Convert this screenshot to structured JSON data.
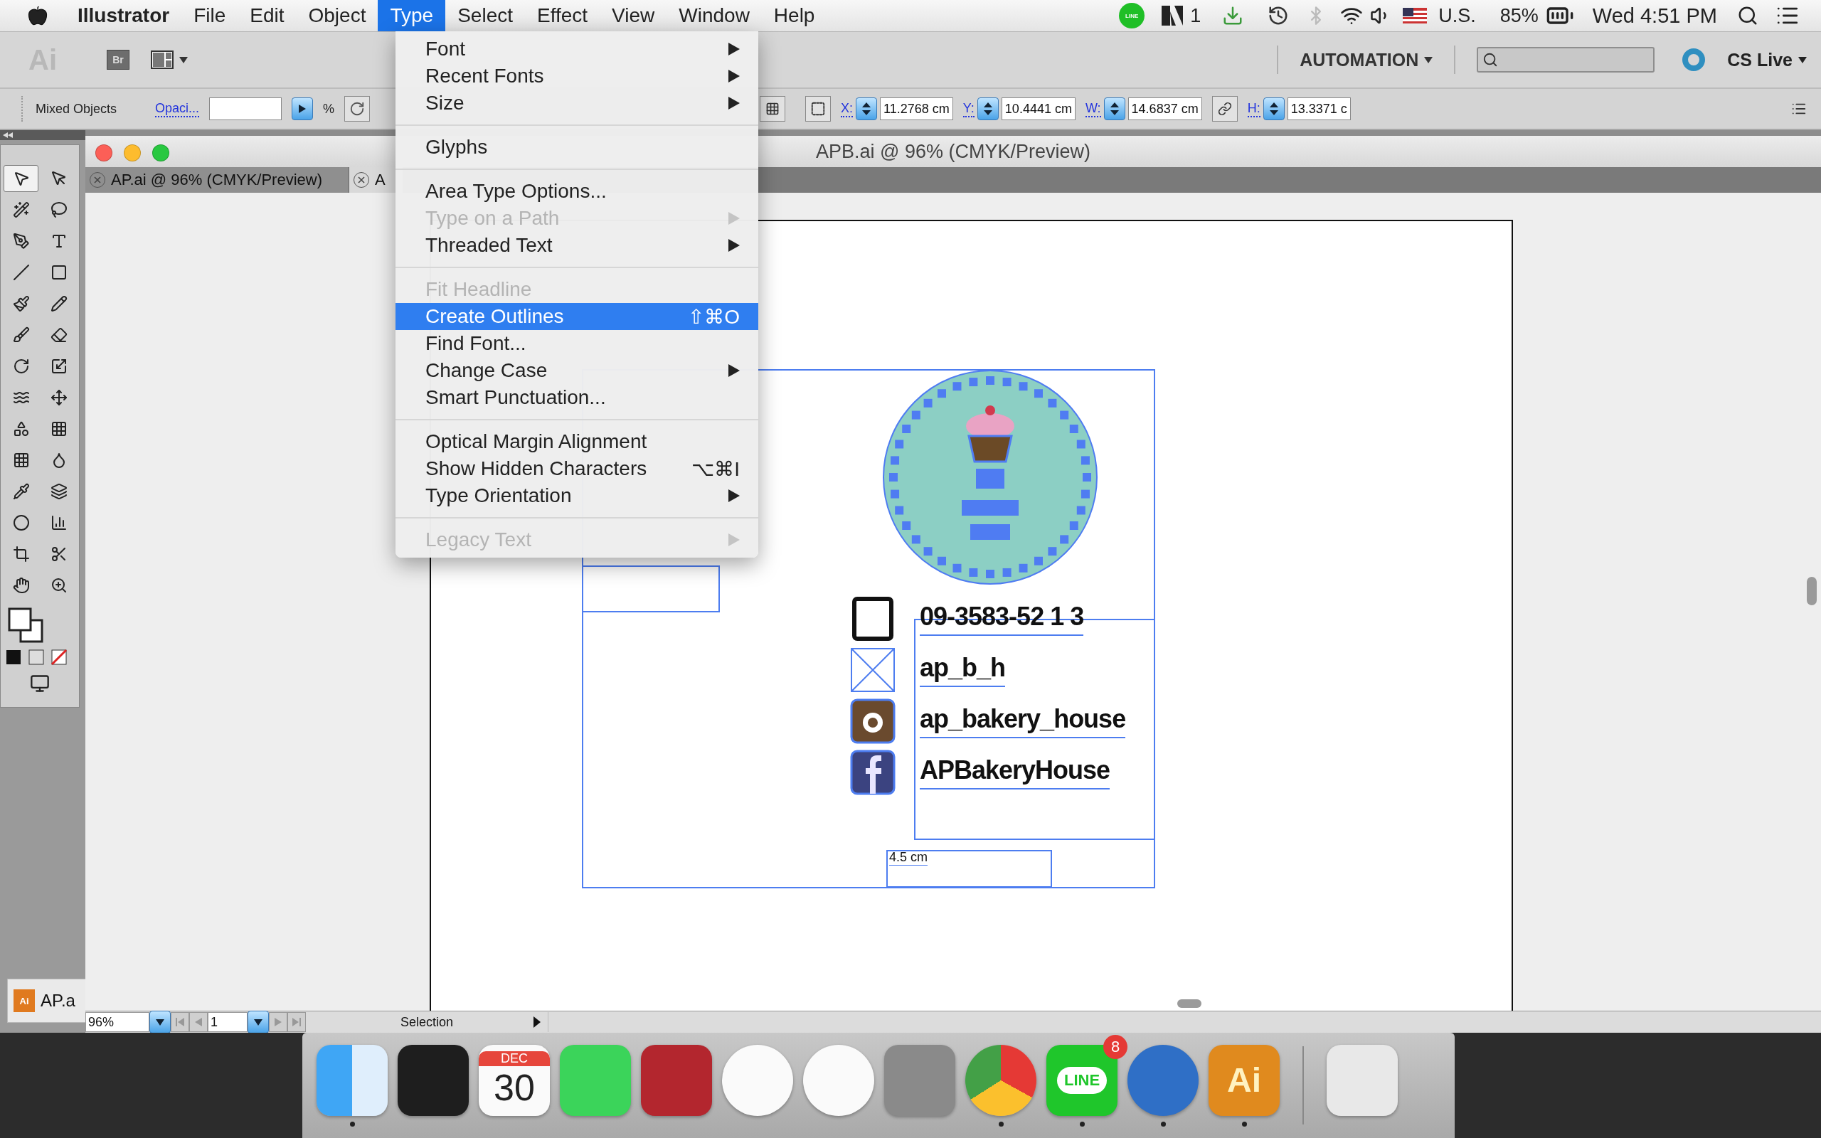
{
  "menu_bar": {
    "app_name": "Illustrator",
    "menus": [
      {
        "label": "File",
        "selected": false
      },
      {
        "label": "Edit",
        "selected": false
      },
      {
        "label": "Object",
        "selected": false
      },
      {
        "label": "Type",
        "selected": true
      },
      {
        "label": "Select",
        "selected": false
      },
      {
        "label": "Effect",
        "selected": false
      },
      {
        "label": "View",
        "selected": false
      },
      {
        "label": "Window",
        "selected": false
      },
      {
        "label": "Help",
        "selected": false
      }
    ],
    "status": {
      "line_label": "LINE",
      "adobe_count": "1",
      "input_source": "U.S.",
      "battery": "85%",
      "clock": "Wed 4:51 PM"
    }
  },
  "app_bar": {
    "logo": "Ai",
    "bridge": "Br",
    "workspace": "AUTOMATION",
    "cs_live": "CS Live"
  },
  "control_bar": {
    "selection": "Mixed Objects",
    "opacity_label": "Opaci...",
    "opacity_unit": "%",
    "fields": [
      {
        "label": "X:",
        "value": "11.2768 cm"
      },
      {
        "label": "Y:",
        "value": "10.4441 cm"
      },
      {
        "label": "W:",
        "value": "14.6837 cm"
      },
      {
        "label": "H:",
        "value": "13.3371 c"
      }
    ]
  },
  "minimized_window": {
    "file_icon_label": "Ai",
    "label": "AP.a"
  },
  "document": {
    "title": "APB.ai @ 96% (CMYK/Preview)",
    "tabs": [
      {
        "label": "AP.ai @ 96% (CMYK/Preview)",
        "selected": false
      },
      {
        "label": "A",
        "selected": true
      }
    ],
    "artwork": {
      "contact_lines": [
        {
          "kind": "phone",
          "text": "09-3583-52 1 3"
        },
        {
          "kind": "placeholder",
          "text": "ap_b_h"
        },
        {
          "kind": "instagram",
          "text": "ap_bakery_house"
        },
        {
          "kind": "facebook",
          "text": "APBakeryHouse"
        }
      ],
      "dimension_label": "4.5 cm"
    },
    "status_bar": {
      "zoom": "96%",
      "page": "1",
      "tool": "Selection"
    }
  },
  "type_menu": {
    "items": [
      {
        "kind": "item",
        "label": "Font",
        "submenu": true,
        "disabled": false,
        "selected": false
      },
      {
        "kind": "item",
        "label": "Recent Fonts",
        "submenu": true,
        "disabled": false,
        "selected": false
      },
      {
        "kind": "item",
        "label": "Size",
        "submenu": true,
        "disabled": false,
        "selected": false
      },
      {
        "kind": "separator"
      },
      {
        "kind": "item",
        "label": "Glyphs",
        "submenu": false,
        "disabled": false,
        "selected": false
      },
      {
        "kind": "separator"
      },
      {
        "kind": "item",
        "label": "Area Type Options...",
        "submenu": false,
        "disabled": false,
        "selected": false
      },
      {
        "kind": "item",
        "label": "Type on a Path",
        "submenu": true,
        "disabled": true,
        "selected": false
      },
      {
        "kind": "item",
        "label": "Threaded Text",
        "submenu": true,
        "disabled": false,
        "selected": false
      },
      {
        "kind": "separator"
      },
      {
        "kind": "item",
        "label": "Fit Headline",
        "submenu": false,
        "disabled": true,
        "selected": false
      },
      {
        "kind": "item",
        "label": "Create Outlines",
        "shortcut": "⇧⌘O",
        "submenu": false,
        "disabled": false,
        "selected": true
      },
      {
        "kind": "item",
        "label": "Find Font...",
        "submenu": false,
        "disabled": false,
        "selected": false
      },
      {
        "kind": "item",
        "label": "Change Case",
        "submenu": true,
        "disabled": false,
        "selected": false
      },
      {
        "kind": "item",
        "label": "Smart Punctuation...",
        "submenu": false,
        "disabled": false,
        "selected": false
      },
      {
        "kind": "separator"
      },
      {
        "kind": "item",
        "label": "Optical Margin Alignment",
        "submenu": false,
        "disabled": false,
        "selected": false
      },
      {
        "kind": "item",
        "label": "Show Hidden Characters",
        "shortcut": "⌥⌘I",
        "submenu": false,
        "disabled": false,
        "selected": false
      },
      {
        "kind": "item",
        "label": "Type Orientation",
        "submenu": true,
        "disabled": false,
        "selected": false
      },
      {
        "kind": "separator"
      },
      {
        "kind": "item",
        "label": "Legacy Text",
        "submenu": true,
        "disabled": true,
        "selected": false
      }
    ]
  },
  "dock": {
    "apps": [
      {
        "kind": "finder",
        "running": true
      },
      {
        "kind": "mission-control",
        "running": false
      },
      {
        "kind": "calendar",
        "month": "DEC",
        "day": "30",
        "running": false
      },
      {
        "kind": "facetime",
        "running": false
      },
      {
        "kind": "photo-booth",
        "running": false
      },
      {
        "kind": "photos",
        "running": false
      },
      {
        "kind": "music",
        "running": false
      },
      {
        "kind": "settings",
        "running": false
      },
      {
        "kind": "chrome",
        "running": true
      },
      {
        "kind": "line",
        "label": "LINE",
        "badge": "8",
        "running": true
      },
      {
        "kind": "office",
        "running": true
      },
      {
        "kind": "illustrator",
        "label": "Ai",
        "running": true
      },
      {
        "kind": "trash",
        "running": false
      }
    ]
  }
}
